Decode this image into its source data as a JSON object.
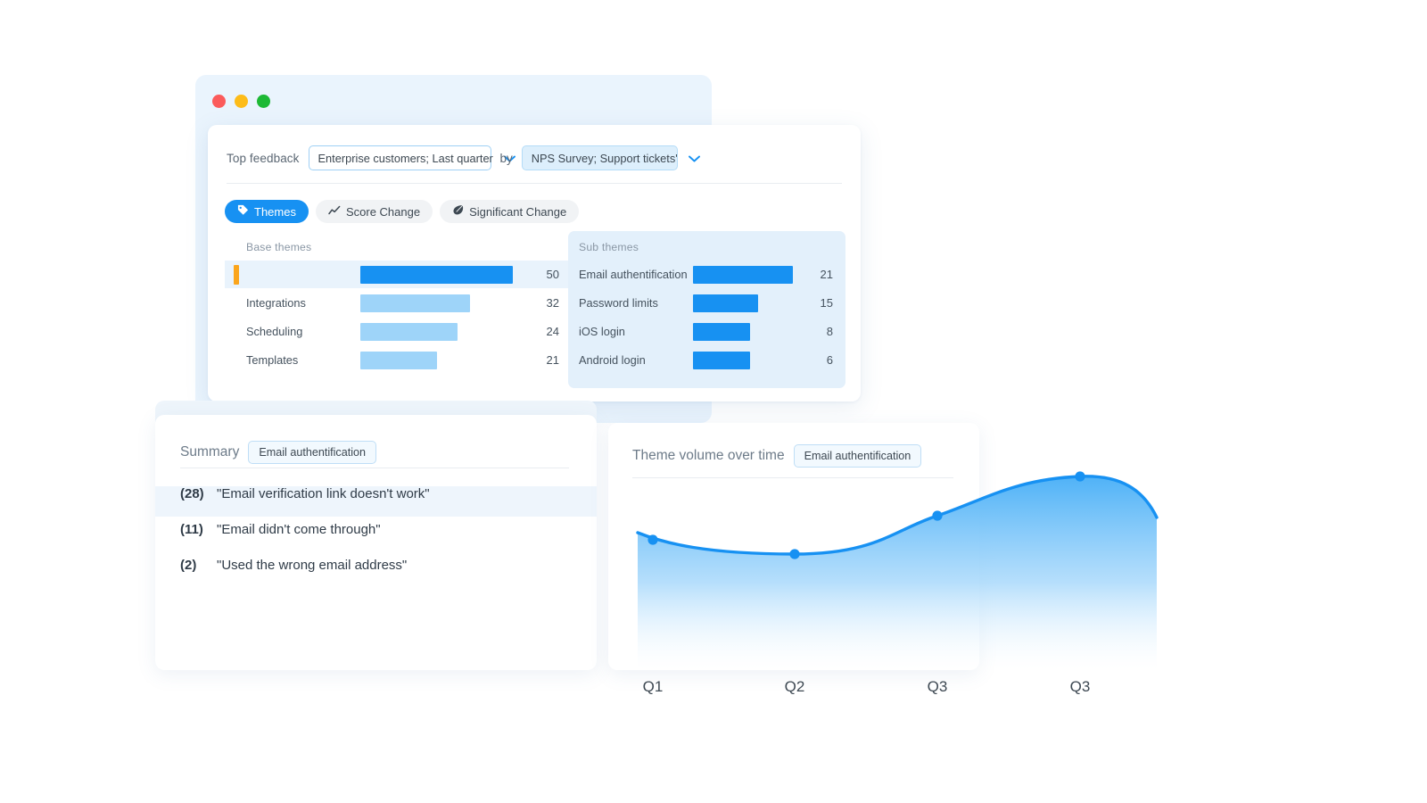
{
  "window": {
    "dots": [
      {
        "name": "close-dot",
        "color": "#fb5b5b"
      },
      {
        "name": "minimize-dot",
        "color": "#fdbc19"
      },
      {
        "name": "maximize-dot",
        "color": "#1db935"
      }
    ]
  },
  "filters": {
    "label": "Top feedback",
    "segment_select": {
      "value": "Enterprise customers; Last quarter",
      "icon": "chevron-down-icon"
    },
    "by_label": "by",
    "source_select": {
      "value": "NPS Survey; Support tickets'",
      "icon": "chevron-down-icon"
    }
  },
  "tabs": [
    {
      "label": "Themes",
      "icon": "tag-icon",
      "active": true
    },
    {
      "label": "Score Change",
      "icon": "line-chart-icon",
      "active": false
    },
    {
      "label": "Significant Change",
      "icon": "comet-icon",
      "active": false
    }
  ],
  "base_themes": {
    "title": "Base themes",
    "rows": [
      {
        "label": "",
        "value": 50,
        "selected": true
      },
      {
        "label": "Integrations",
        "value": 32,
        "selected": false
      },
      {
        "label": "Scheduling",
        "value": 24,
        "selected": false
      },
      {
        "label": "Templates",
        "value": 21,
        "selected": false
      }
    ]
  },
  "sub_themes": {
    "title": "Sub themes",
    "rows": [
      {
        "label": "Email authentification",
        "value": 21
      },
      {
        "label": "Password limits",
        "value": 15
      },
      {
        "label": "iOS login",
        "value": 8
      },
      {
        "label": "Android login",
        "value": 6
      }
    ]
  },
  "summary": {
    "title": "Summary",
    "chip": "Email authentification",
    "items": [
      {
        "count": "(28)",
        "text": "\"Email verification link doesn't work\"",
        "highlighted": true
      },
      {
        "count": "(11)",
        "text": "\"Email didn't come through\"",
        "highlighted": false
      },
      {
        "count": "(2)",
        "text": "\"Used the wrong email address\"",
        "highlighted": false
      }
    ]
  },
  "chart_panel": {
    "title": "Theme volume over time",
    "chip": "Email authentification"
  },
  "chart_data": {
    "type": "area",
    "title": "Theme volume over time",
    "xlabel": "",
    "ylabel": "",
    "categories": [
      "Q1",
      "Q2",
      "Q3",
      "Q3"
    ],
    "values": [
      43,
      38,
      52,
      64
    ],
    "series": [
      {
        "name": "Email authentification",
        "values": [
          43,
          38,
          52,
          64
        ]
      }
    ],
    "ylim": [
      0,
      80
    ],
    "grid": false,
    "legend": "none",
    "line_color": "#1791f2",
    "fill_top_color": "#4fb2f7",
    "fill_bottom_color": "#ffffff",
    "point_color": "#1791f2",
    "smoothing": "monotone-spline"
  },
  "colors": {
    "accent_blue": "#1791f2",
    "light_blue_bar": "#9ed4f9",
    "panel_blue": "#e3f0fb",
    "backdrop_blue": "#eaf4fd",
    "orange_accent": "#fba51c",
    "text_dark": "#2f3b47",
    "text_muted": "#8a97a5"
  }
}
